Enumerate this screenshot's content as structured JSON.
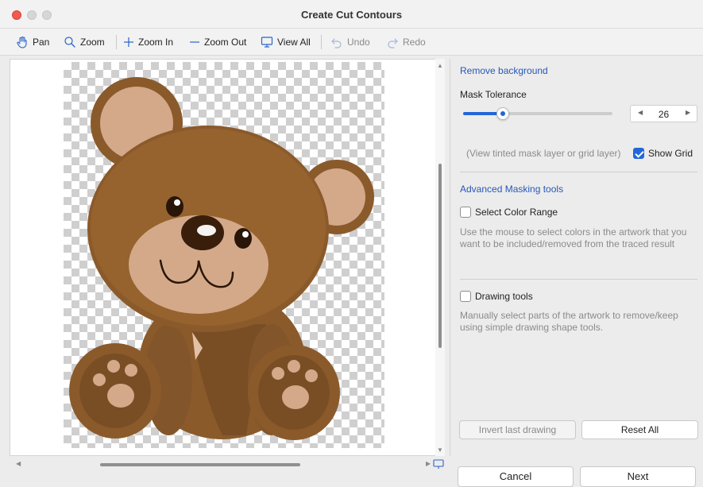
{
  "window": {
    "title": "Create Cut Contours"
  },
  "toolbar": {
    "pan": "Pan",
    "zoom": "Zoom",
    "zoom_in": "Zoom In",
    "zoom_out": "Zoom Out",
    "view_all": "View All",
    "undo": "Undo",
    "redo": "Redo"
  },
  "panel": {
    "remove_background": "Remove background",
    "mask_tolerance_label": "Mask Tolerance",
    "mask_tolerance_value": "26",
    "mask_tolerance_fraction": 0.26,
    "grid_hint": "(View tinted mask layer or grid layer)",
    "show_grid_label": "Show Grid",
    "show_grid_checked": true,
    "advanced_header": "Advanced Masking tools",
    "select_color_range_label": "Select Color Range",
    "select_color_range_desc": "Use the mouse to select colors in the artwork that you want to be included/removed from the traced result",
    "drawing_tools_label": "Drawing tools",
    "drawing_tools_desc": "Manually select parts of the artwork to remove/keep using simple drawing shape tools.",
    "invert_label": "Invert last drawing",
    "reset_label": "Reset All"
  },
  "footer": {
    "cancel": "Cancel",
    "next": "Next"
  },
  "colors": {
    "accent": "#2167d8",
    "section_heading": "#2857b8"
  }
}
